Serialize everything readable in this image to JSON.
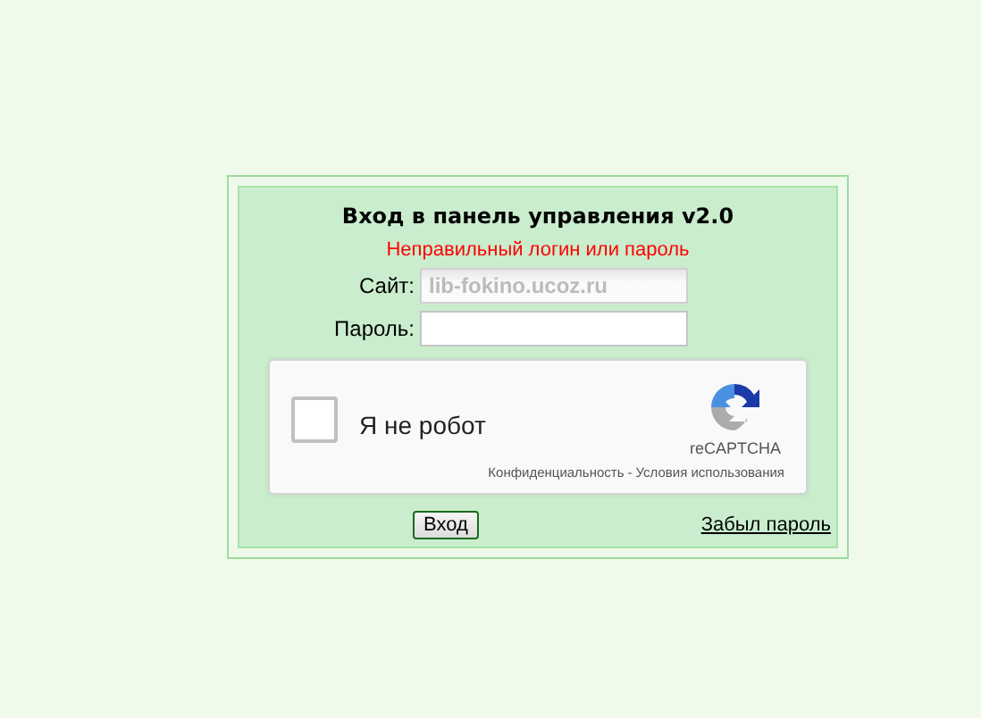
{
  "login_panel": {
    "title": "Вход в панель управления v2.0",
    "error": "Неправильный логин или пароль",
    "fields": [
      {
        "label": "Сайт:",
        "value": "lib-fokino.ucoz.ru",
        "disabled": true
      },
      {
        "label": "Пароль:",
        "disabled": false
      }
    ],
    "captcha": {
      "label": "Я не робот",
      "checked": false,
      "brand": "reCAPTCHA",
      "privacy": "Конфиденциальность",
      "separator": "-",
      "terms": "Условия использования"
    },
    "submit": "Вход",
    "forgot_link": "Забыл пароль"
  }
}
